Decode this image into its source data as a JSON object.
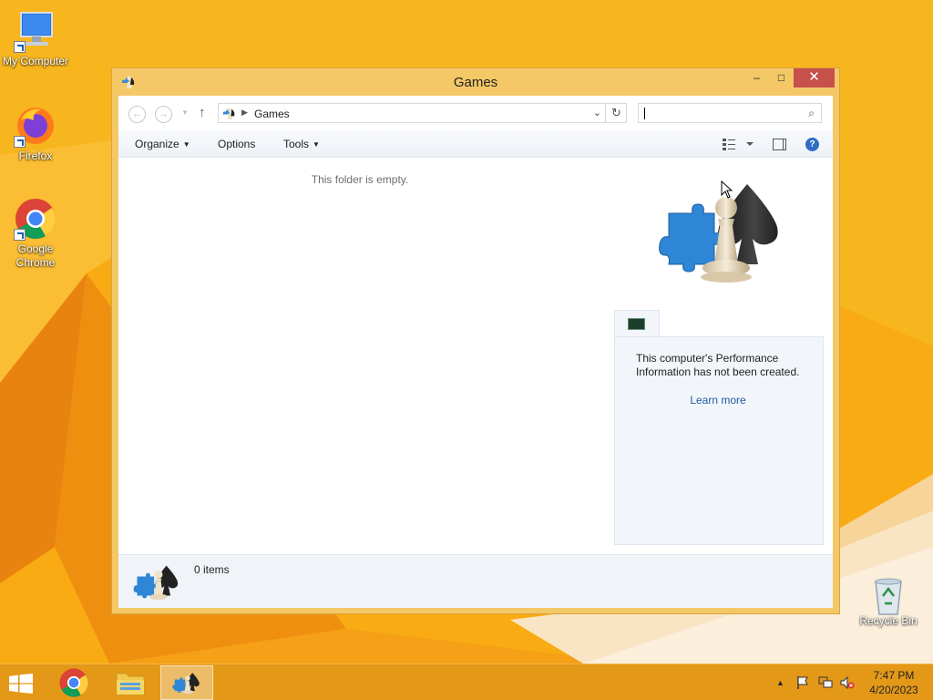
{
  "desktop": {
    "icons": [
      {
        "label": "My Computer",
        "icon": "computer-icon"
      },
      {
        "label": "Firefox",
        "icon": "firefox-icon"
      },
      {
        "label": "Google Chrome",
        "icon": "chrome-icon"
      },
      {
        "label": "Recycle Bin",
        "icon": "recycle-bin-icon"
      }
    ]
  },
  "window": {
    "title": "Games",
    "controls": {
      "minimize": "–",
      "maximize": "□",
      "close": "✕"
    },
    "address": {
      "path": "Games"
    },
    "search": {
      "placeholder": ""
    },
    "toolbar": {
      "organize": "Organize",
      "options": "Options",
      "tools": "Tools"
    },
    "content": {
      "empty_message": "This folder is empty."
    },
    "preview": {
      "performance_message": "This computer's Performance Information has not been created.",
      "learn_more": "Learn more"
    },
    "details": {
      "item_count": "0 items"
    }
  },
  "taskbar": {
    "items": [
      {
        "name": "start",
        "icon": "windows-logo-icon"
      },
      {
        "name": "chrome",
        "icon": "chrome-icon"
      },
      {
        "name": "file-explorer",
        "icon": "file-explorer-icon"
      },
      {
        "name": "games",
        "icon": "games-icon",
        "active": true
      }
    ],
    "clock": {
      "time": "7:47 PM",
      "date": "4/20/2023"
    }
  },
  "colors": {
    "wallpaper": "#f7a712",
    "window_frame": "#f4c866",
    "close_button": "#c7504b",
    "link": "#1e5aa8"
  }
}
